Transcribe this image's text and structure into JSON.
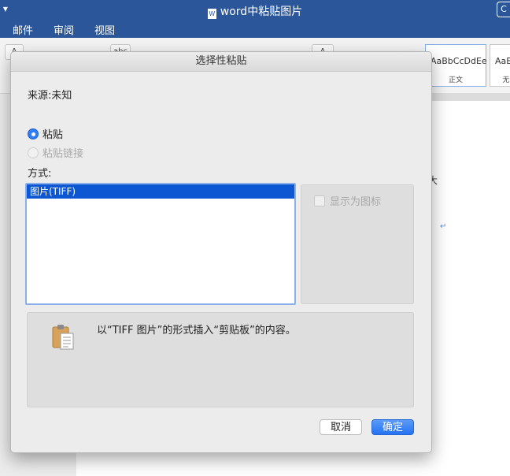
{
  "window": {
    "title": "word中粘贴图片",
    "right_button": "C",
    "left_glyph": "▾"
  },
  "menubar": {
    "items": [
      "邮件",
      "审阅",
      "视图"
    ]
  },
  "ribbon": {
    "styles": [
      {
        "sample": "AaBbCcDdEe",
        "name": "正文"
      },
      {
        "sample": "AaBb",
        "name": "无"
      }
    ],
    "small_labels": [
      "A",
      "abc",
      "A"
    ]
  },
  "document": {
    "visible_char": "大",
    "return_mark": "↵"
  },
  "dialog": {
    "title": "选择性粘贴",
    "source_label": "来源:",
    "source_value": "未知",
    "radio_paste": "粘贴",
    "radio_paste_link": "粘贴链接",
    "mode_label": "方式:",
    "formats": [
      "图片(TIFF)"
    ],
    "selected_format_index": 0,
    "display_as_icon": "显示为图标",
    "result_text": "以“TIFF 图片”的形式插入“剪贴板”的内容。",
    "cancel_label": "取消",
    "ok_label": "确定",
    "accent_color": "#2f7cf6"
  }
}
